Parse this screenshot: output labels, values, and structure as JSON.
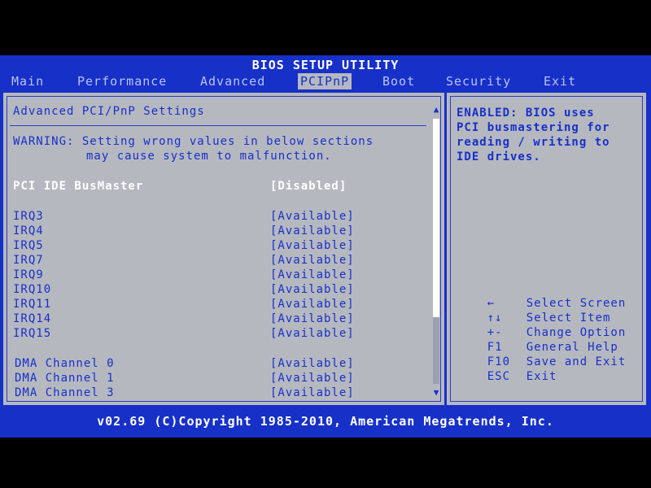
{
  "title": "BIOS SETUP UTILITY",
  "tabs": [
    {
      "label": "Main",
      "active": false
    },
    {
      "label": "Performance",
      "active": false
    },
    {
      "label": "Advanced",
      "active": false
    },
    {
      "label": "PCIPnP",
      "active": true
    },
    {
      "label": "Boot",
      "active": false
    },
    {
      "label": "Security",
      "active": false
    },
    {
      "label": "Exit",
      "active": false
    }
  ],
  "main": {
    "section_title": "Advanced PCI/PnP Settings",
    "warning_line1": "WARNING: Setting wrong values in below sections",
    "warning_line2": "may cause system to malfunction.",
    "settings": [
      {
        "label": "PCI IDE BusMaster",
        "value": "[Disabled]",
        "selected": true
      },
      {
        "label": "IRQ3",
        "value": "[Available]"
      },
      {
        "label": "IRQ4",
        "value": "[Available]"
      },
      {
        "label": "IRQ5",
        "value": "[Available]"
      },
      {
        "label": "IRQ7",
        "value": "[Available]"
      },
      {
        "label": "IRQ9",
        "value": "[Available]"
      },
      {
        "label": "IRQ10",
        "value": "[Available]"
      },
      {
        "label": "IRQ11",
        "value": "[Available]"
      },
      {
        "label": "IRQ14",
        "value": "[Available]"
      },
      {
        "label": "IRQ15",
        "value": "[Available]"
      },
      {
        "label": "DMA Channel 0",
        "value": "[Available]"
      },
      {
        "label": "DMA Channel 1",
        "value": "[Available]"
      },
      {
        "label": "DMA Channel 3",
        "value": "[Available]"
      }
    ]
  },
  "help": {
    "line1": "ENABLED: BIOS uses",
    "line2": "PCI busmastering for",
    "line3": "reading / writing to",
    "line4": "IDE drives.",
    "keys": [
      {
        "key": "←",
        "action": "Select Screen"
      },
      {
        "key": "↑↓",
        "action": "Select Item"
      },
      {
        "key": "+-",
        "action": "Change Option"
      },
      {
        "key": "F1",
        "action": "General Help"
      },
      {
        "key": "F10",
        "action": "Save and Exit"
      },
      {
        "key": "ESC",
        "action": "Exit"
      }
    ]
  },
  "footer": "v02.69 (C)Copyright 1985-2010, American Megatrends, Inc.",
  "colors": {
    "background": "#1730c8",
    "panel": "#b6b8c0",
    "text": "#1730c8",
    "highlight": "#ffffff"
  }
}
